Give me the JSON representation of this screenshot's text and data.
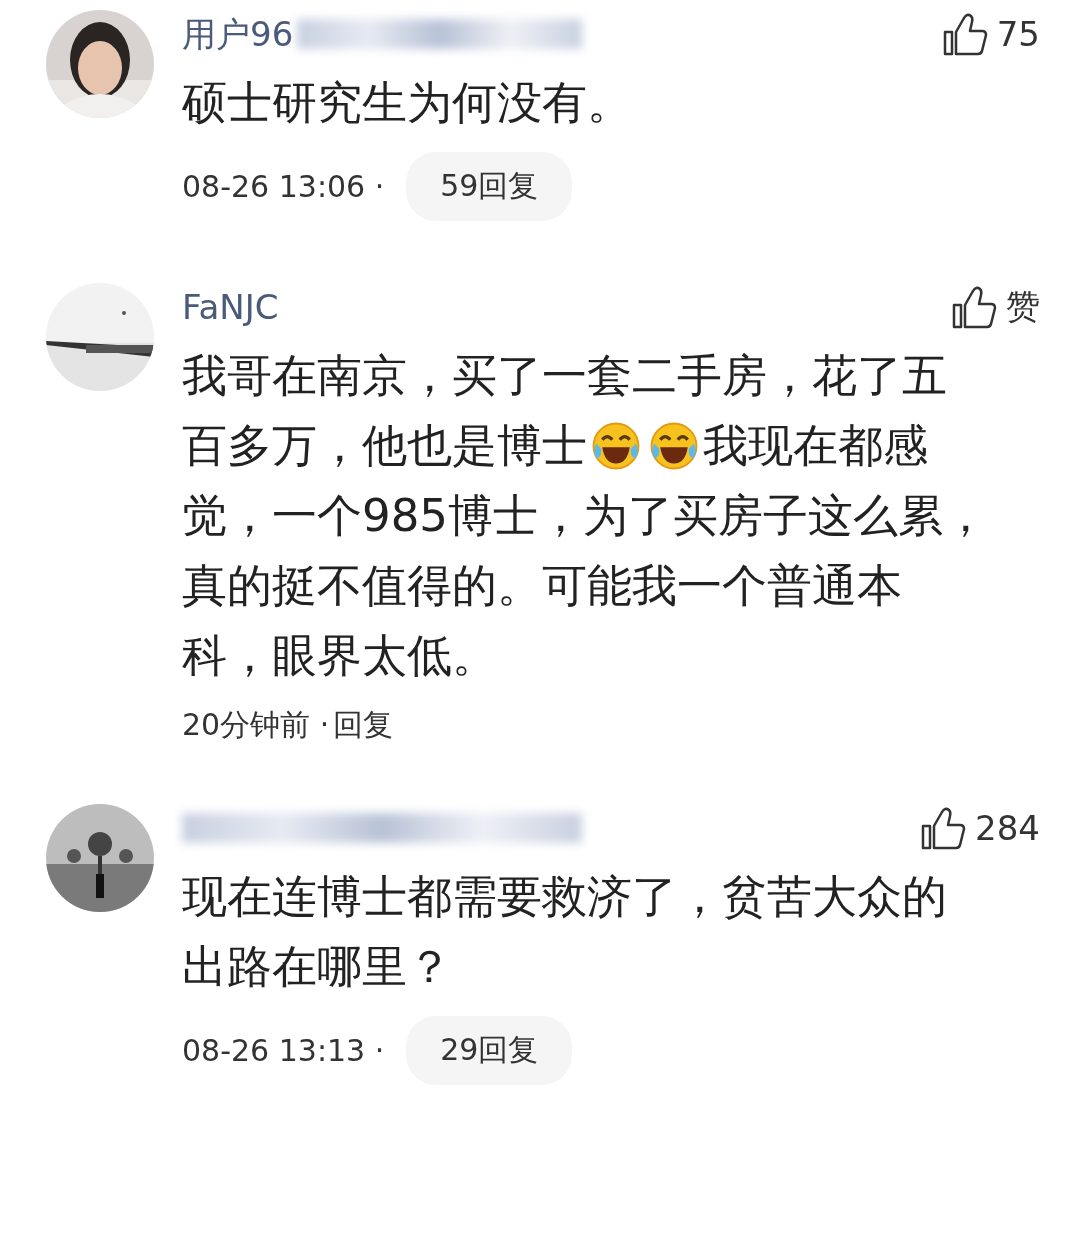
{
  "comments": [
    {
      "username": "用户96",
      "username_blurred": true,
      "likes": "75",
      "lines": [
        [
          {
            "kind": "text",
            "text": "硕士研究生为何没有。"
          }
        ]
      ],
      "time": "08-26 13:06 ·",
      "reply": {
        "kind": "pill",
        "label": "59回复"
      }
    },
    {
      "username": "FaNJC",
      "username_blurred": false,
      "likes": "赞",
      "lines": [
        [
          {
            "kind": "text",
            "text": "我哥在南京，买了一套二手房，花了五"
          }
        ],
        [
          {
            "kind": "text",
            "text": "百多万，他也是博士"
          },
          {
            "kind": "emoji"
          },
          {
            "kind": "emoji"
          },
          {
            "kind": "text",
            "text": "我现在都感"
          }
        ],
        [
          {
            "kind": "text",
            "text": "觉，一个985博士，为了买房子这么累，"
          }
        ],
        [
          {
            "kind": "text",
            "text": "真的挺不值得的。可能我一个普通本"
          }
        ],
        [
          {
            "kind": "text",
            "text": "科，眼界太低。"
          }
        ]
      ],
      "time": "20分钟前 ·",
      "reply": {
        "kind": "plain",
        "label": "回复"
      }
    },
    {
      "username_blurred": true,
      "likes": "284",
      "lines": [
        [
          {
            "kind": "text",
            "text": "现在连博士都需要救济了，贫苦大众的"
          }
        ],
        [
          {
            "kind": "text",
            "text": "出路在哪里？"
          }
        ]
      ],
      "time": "08-26 13:13 ·",
      "reply": {
        "kind": "pill",
        "label": "29回复"
      }
    }
  ]
}
